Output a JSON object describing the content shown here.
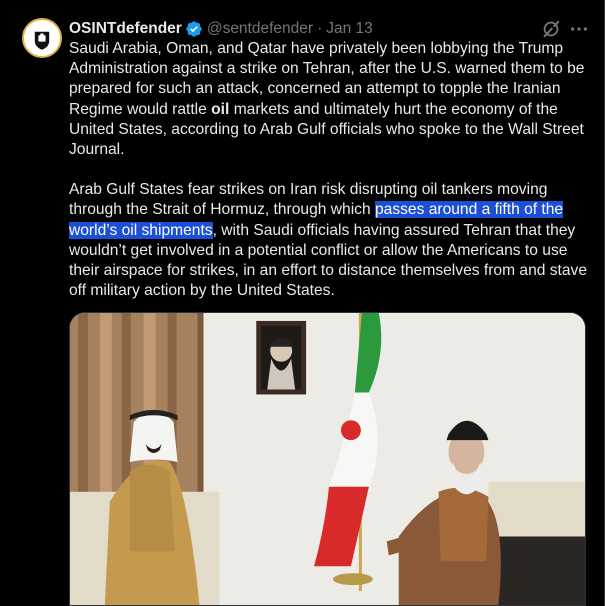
{
  "tweet": {
    "author_name": "OSINTdefender",
    "handle": "@sentdefender",
    "separator": "·",
    "date": "Jan 13",
    "p1_a": "Saudi Arabia, Oman, and Qatar have privately been lobbying the Trump Administration against a strike on Tehran, after the U.S. warned them to be prepared for such an attack, concerned an attempt to topple the Iranian Regime would rattle ",
    "p1_bold": "oil",
    "p1_b": " markets and ultimately hurt the economy of the United States, according to Arab Gulf officials who spoke to the Wall Street Journal.",
    "p2_a": "Arab Gulf States fear strikes on Iran risk disrupting oil tankers moving through the Strait of Hormuz, through which ",
    "p2_highlight": "passes around a fifth of the world’s oil shipments",
    "p2_b": ", with Saudi officials having assured Tehran that they wouldn’t get involved in a potential conflict or allow the Americans to use their airspace for strikes, in an effort to distance themselves from and stave off military action by the United States."
  },
  "icons": {
    "verified": "verified-badge-icon",
    "grok": "grok-icon",
    "more": "more-options-icon"
  },
  "colors": {
    "background": "#000000",
    "text": "#e7e9ea",
    "secondary": "#71767b",
    "verified": "#1d9bf0",
    "highlight": "#1a4fd6"
  }
}
